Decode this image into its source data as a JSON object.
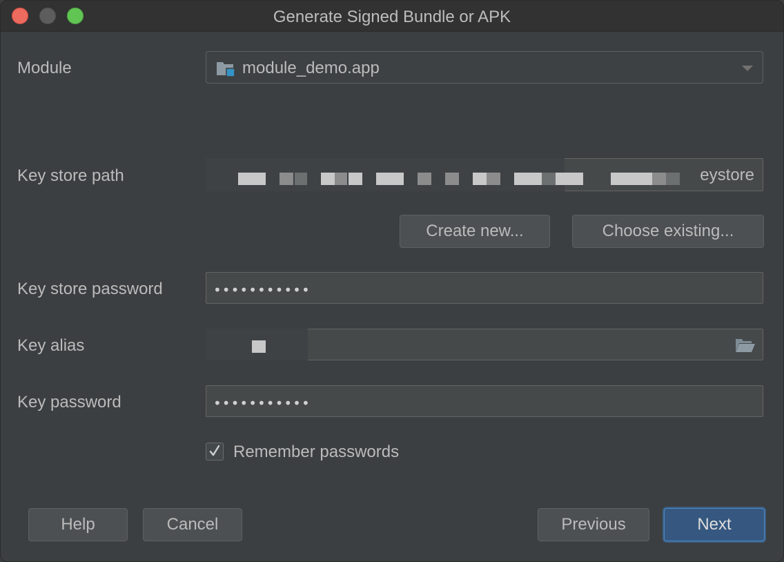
{
  "window": {
    "title": "Generate Signed Bundle or APK"
  },
  "form": {
    "module_label": "Module",
    "module_value": "module_demo.app",
    "key_store_path_label": "Key store path",
    "key_store_path_suffix": "eystore",
    "create_new_label": "Create new...",
    "choose_existing_label": "Choose existing...",
    "key_store_password_label": "Key store password",
    "key_store_password_value": "•••••••••••",
    "key_alias_label": "Key alias",
    "key_password_label": "Key password",
    "key_password_value": "•••••••••••",
    "remember_passwords_label": "Remember passwords",
    "remember_passwords_checked": true
  },
  "footer": {
    "help_label": "Help",
    "cancel_label": "Cancel",
    "previous_label": "Previous",
    "next_label": "Next"
  },
  "icons": {
    "module": "module-folder-icon",
    "dropdown": "chevron-down-icon",
    "alias_browse": "folder-open-icon",
    "checkbox": "check-icon"
  },
  "colors": {
    "background": "#3c3f41",
    "titlebar": "#323232",
    "field": "#45494a",
    "primary_button": "#365880",
    "primary_border": "#4a88c7",
    "close": "#ed6a5e",
    "maximize": "#61c554",
    "module_icon_accent": "#3592c4"
  }
}
